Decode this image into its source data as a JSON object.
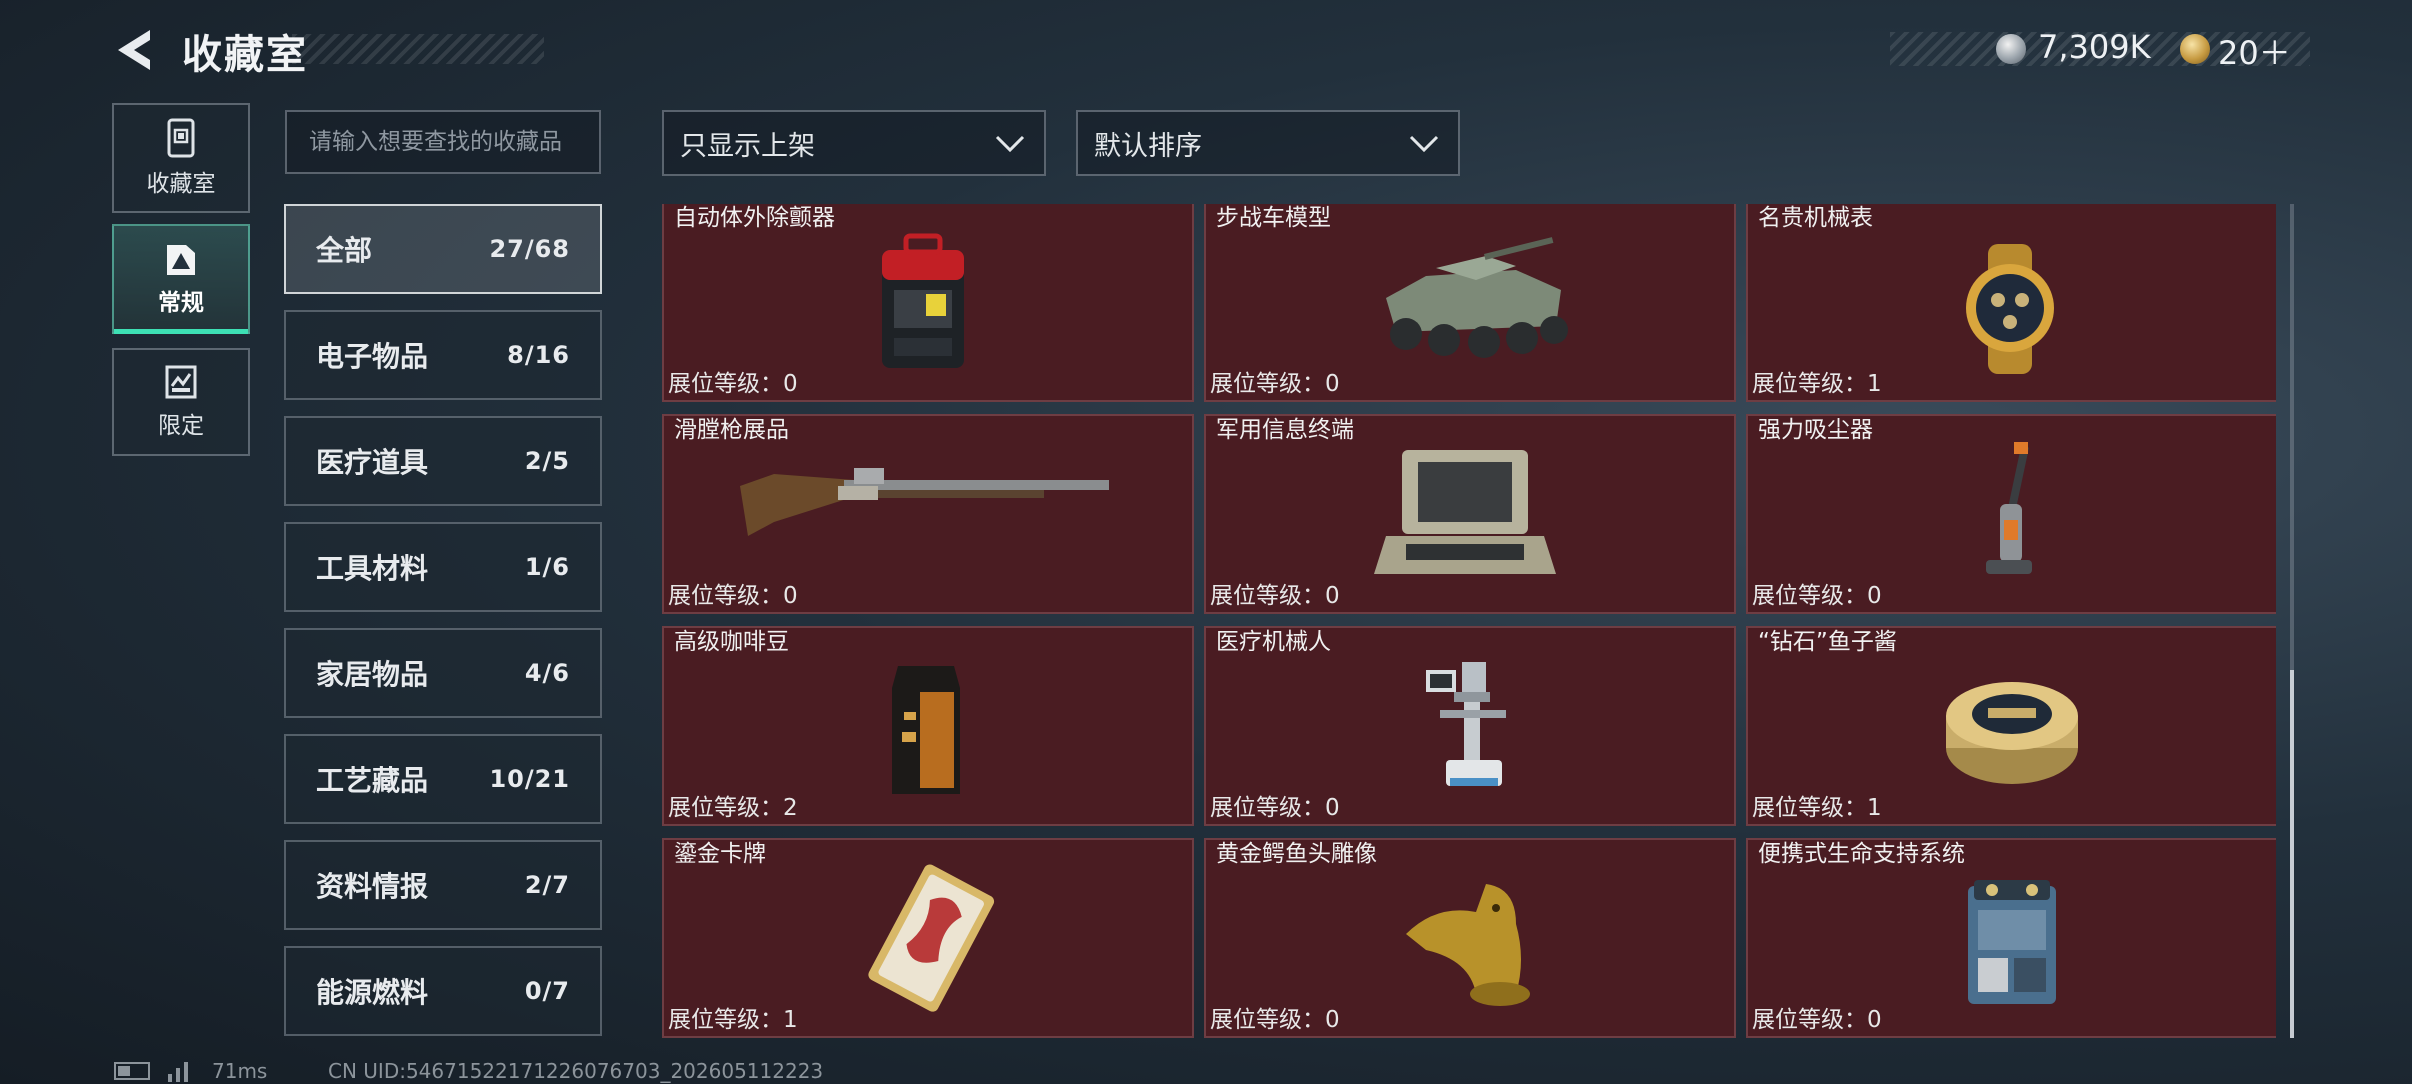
{
  "header": {
    "title": "收藏室",
    "currency1": "7,309K",
    "currency2": "20＋",
    "currency1_icon": "silver-coin-icon",
    "currency2_icon": "gold-coin-icon"
  },
  "left_nav": [
    {
      "label": "收藏室",
      "icon": "collection-icon"
    },
    {
      "label": "常规",
      "icon": "regular-icon",
      "active": true
    },
    {
      "label": "限定",
      "icon": "limited-icon"
    }
  ],
  "search": {
    "placeholder": "请输入想要查找的收藏品"
  },
  "filter": {
    "selected": "只显示上架"
  },
  "sort": {
    "selected": "默认排序"
  },
  "categories": [
    {
      "name": "全部",
      "count": "27/68",
      "active": true
    },
    {
      "name": "电子物品",
      "count": "8/16"
    },
    {
      "name": "医疗道具",
      "count": "2/5"
    },
    {
      "name": "工具材料",
      "count": "1/6"
    },
    {
      "name": "家居物品",
      "count": "4/6"
    },
    {
      "name": "工艺藏品",
      "count": "10/21"
    },
    {
      "name": "资料情报",
      "count": "2/7"
    },
    {
      "name": "能源燃料",
      "count": "0/7"
    }
  ],
  "items": [
    {
      "name": "自动体外除颤器",
      "level": "展位等级：0",
      "icon": "defibrillator-icon"
    },
    {
      "name": "步战车模型",
      "level": "展位等级：0",
      "icon": "ifv-model-icon"
    },
    {
      "name": "名贵机械表",
      "level": "展位等级：1",
      "icon": "watch-icon"
    },
    {
      "name": "滑膛枪展品",
      "level": "展位等级：0",
      "icon": "musket-icon"
    },
    {
      "name": "军用信息终端",
      "level": "展位等级：0",
      "icon": "terminal-icon"
    },
    {
      "name": "强力吸尘器",
      "level": "展位等级：0",
      "icon": "vacuum-icon"
    },
    {
      "name": "高级咖啡豆",
      "level": "展位等级：2",
      "icon": "coffee-bag-icon"
    },
    {
      "name": "医疗机械人",
      "level": "展位等级：0",
      "icon": "medical-robot-icon"
    },
    {
      "name": "“钻石”鱼子酱",
      "level": "展位等级：1",
      "icon": "caviar-tin-icon"
    },
    {
      "name": "鎏金卡牌",
      "level": "展位等级：1",
      "icon": "gilded-card-icon"
    },
    {
      "name": "黄金鳄鱼头雕像",
      "level": "展位等级：0",
      "icon": "croc-statue-icon"
    },
    {
      "name": "便携式生命支持系统",
      "level": "展位等级：0",
      "icon": "life-support-icon"
    }
  ],
  "footer": {
    "ping": "71ms",
    "uid": "CN UID:54671522171226076703_202605112223"
  },
  "colors": {
    "card_bg": "#4a1c22",
    "active_tab_accent": "#3de0b4"
  }
}
